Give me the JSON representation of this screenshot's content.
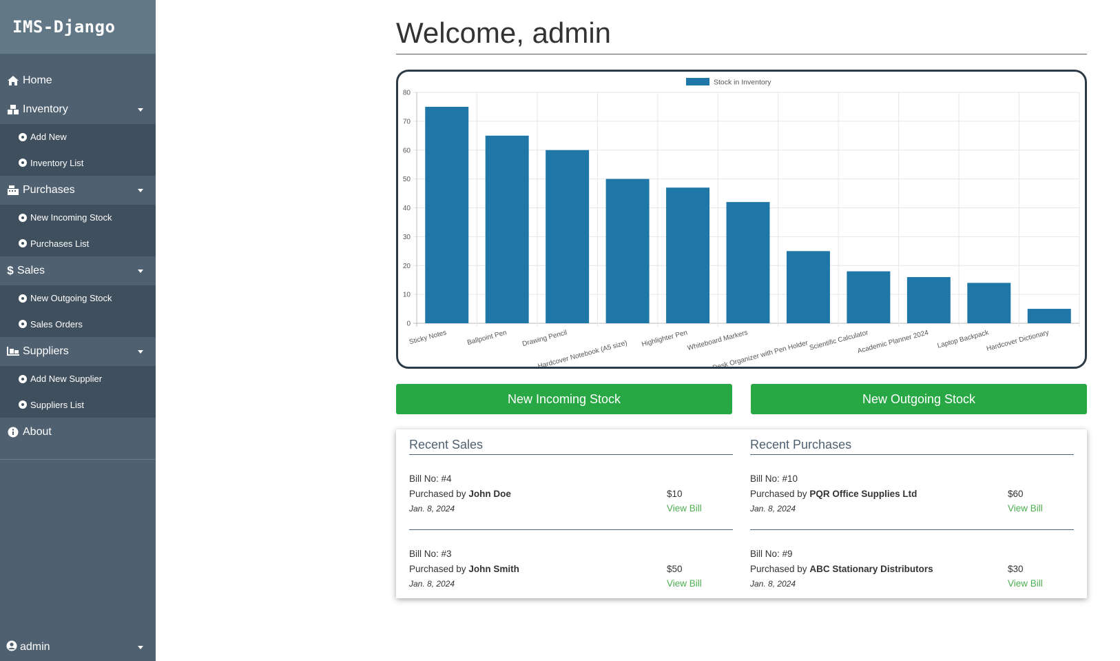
{
  "brand": "IMS-Django",
  "nav": {
    "home": "Home",
    "inventory": {
      "label": "Inventory",
      "items": [
        "Add New",
        "Inventory List"
      ]
    },
    "purchases": {
      "label": "Purchases",
      "items": [
        "New Incoming Stock",
        "Purchases List"
      ]
    },
    "sales": {
      "label": "Sales",
      "items": [
        "New Outgoing Stock",
        "Sales Orders"
      ]
    },
    "suppliers": {
      "label": "Suppliers",
      "items": [
        "Add New Supplier",
        "Suppliers List"
      ]
    },
    "about": "About"
  },
  "user": "admin",
  "welcome": "Welcome, admin",
  "buttons": {
    "incoming": "New Incoming Stock",
    "outgoing": "New Outgoing Stock"
  },
  "recent_sales": {
    "title": "Recent Sales",
    "items": [
      {
        "bill": "Bill No: #4",
        "prefix": "Purchased by",
        "name": "John Doe",
        "date": "Jan. 8, 2024",
        "amount": "$10",
        "view": "View Bill"
      },
      {
        "bill": "Bill No: #3",
        "prefix": "Purchased by",
        "name": "John Smith",
        "date": "Jan. 8, 2024",
        "amount": "$50",
        "view": "View Bill"
      }
    ]
  },
  "recent_purchases": {
    "title": "Recent Purchases",
    "items": [
      {
        "bill": "Bill No: #10",
        "prefix": "Purchased by",
        "name": "PQR Office Supplies Ltd",
        "date": "Jan. 8, 2024",
        "amount": "$60",
        "view": "View Bill"
      },
      {
        "bill": "Bill No: #9",
        "prefix": "Purchased by",
        "name": "ABC Stationary Distributors",
        "date": "Jan. 8, 2024",
        "amount": "$30",
        "view": "View Bill"
      }
    ]
  },
  "colors": {
    "bar": "#1f77a8",
    "accent": "#28a745",
    "sidebar": "#4f6070"
  },
  "chart_data": {
    "type": "bar",
    "categories": [
      "Sticky Notes",
      "Ballpoint Pen",
      "Drawing Pencil",
      "Hardcover Notebook (A5 size)",
      "Highlighter Pen",
      "Whiteboard Markers",
      "Desk Organizer with Pen Holder",
      "Scientific Calculator",
      "Academic Planner 2024",
      "Laptop Backpack",
      "Hardcover Dictionary"
    ],
    "series": [
      {
        "name": "Stock in Inventory",
        "values": [
          75,
          65,
          60,
          50,
          47,
          42,
          25,
          18,
          16,
          14,
          5
        ]
      }
    ],
    "yticks": [
      0,
      10,
      20,
      30,
      40,
      50,
      60,
      70,
      80
    ],
    "ylim": [
      0,
      80
    ],
    "grid": true,
    "legend": "top"
  }
}
